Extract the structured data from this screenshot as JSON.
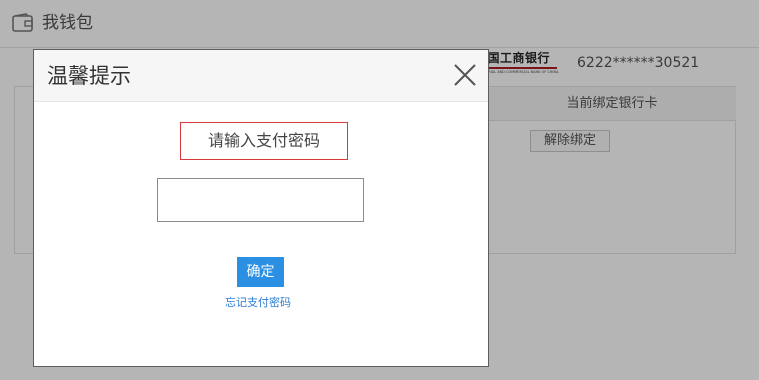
{
  "page": {
    "title": "我钱包",
    "wallet_icon": "wallet-icon"
  },
  "card_panel": {
    "header": "当前绑定银行卡",
    "bank": {
      "name_cn": "中国工商银行",
      "name_en": "INDUSTRIAL AND COMMERCIAL BANK OF CHINA",
      "accent_color": "#7a1515"
    },
    "card_number": "6222******30521",
    "unbind_label": "解除绑定"
  },
  "modal": {
    "title": "温馨提示",
    "close_icon": "close-icon",
    "prompt": "请输入支付密码",
    "password_value": "",
    "confirm_label": "确定",
    "forgot_label": "忘记支付密码",
    "accent_color": "#2b8fe3",
    "prompt_border_color": "#d9373a"
  }
}
